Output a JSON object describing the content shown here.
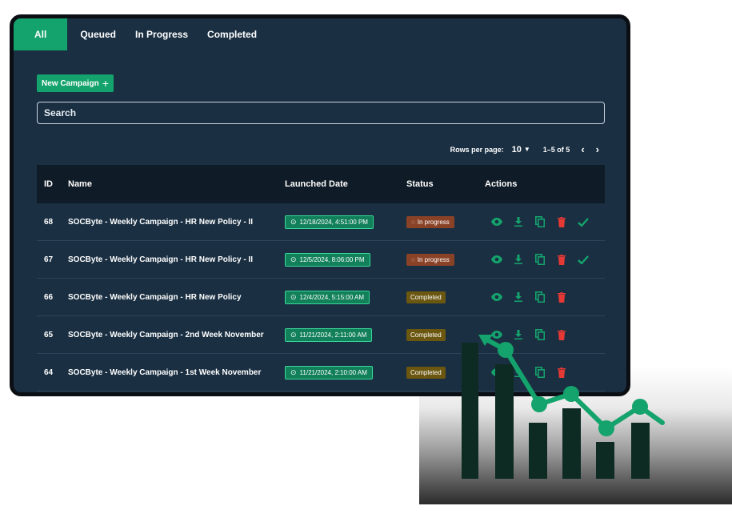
{
  "tabs": [
    {
      "label": "All",
      "active": true
    },
    {
      "label": "Queued",
      "active": false
    },
    {
      "label": "In Progress",
      "active": false
    },
    {
      "label": "Completed",
      "active": false
    }
  ],
  "new_campaign_label": "New Campaign",
  "search": {
    "placeholder": "Search"
  },
  "pagination": {
    "rows_per_page_label": "Rows per page:",
    "rows_per_page_value": "10",
    "range": "1–5 of 5"
  },
  "table": {
    "headers": {
      "id": "ID",
      "name": "Name",
      "date": "Launched Date",
      "status": "Status",
      "actions": "Actions"
    },
    "rows": [
      {
        "id": "68",
        "name": "SOCByte - Weekly Campaign - HR New Policy - II",
        "date": "12/18/2024, 4:51:00 PM",
        "status": "In progress"
      },
      {
        "id": "67",
        "name": "SOCByte - Weekly Campaign - HR New Policy - II",
        "date": "12/5/2024, 8:06:00 PM",
        "status": "In progress"
      },
      {
        "id": "66",
        "name": "SOCByte - Weekly Campaign - HR New Policy",
        "date": "12/4/2024, 5:15:00 AM",
        "status": "Completed"
      },
      {
        "id": "65",
        "name": "SOCByte - Weekly Campaign - 2nd Week November",
        "date": "11/21/2024, 2:11:00 AM",
        "status": "Completed"
      },
      {
        "id": "64",
        "name": "SOCByte - Weekly Campaign - 1st Week November",
        "date": "11/21/2024, 2:10:00 AM",
        "status": "Completed"
      }
    ]
  },
  "colors": {
    "accent": "#14a36c",
    "background": "#1a2f42",
    "header": "#0f1b26",
    "in_progress": "#8a4227",
    "completed": "#6b5710",
    "delete": "#e53935"
  },
  "icons": {
    "view": "eye-icon",
    "download": "download-icon",
    "copy": "copy-icon",
    "delete": "trash-icon",
    "approve": "check-icon"
  }
}
